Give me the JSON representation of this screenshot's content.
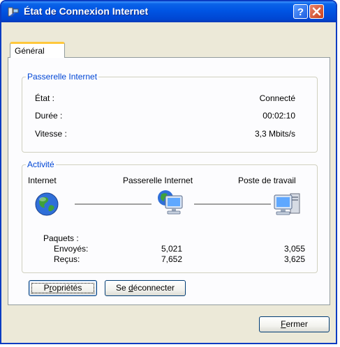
{
  "window": {
    "title": "État de Connexion Internet"
  },
  "tabs": [
    {
      "label": "Général"
    }
  ],
  "gateway": {
    "title": "Passerelle Internet",
    "rows": [
      {
        "label": "État :",
        "value": "Connecté"
      },
      {
        "label": "Durée :",
        "value": "00:02:10"
      },
      {
        "label": "Vitesse :",
        "value": "3,3 Mbits/s"
      }
    ]
  },
  "activity": {
    "title": "Activité",
    "col_internet": "Internet",
    "col_gateway": "Passerelle Internet",
    "col_computer": "Poste de travail",
    "packets_label": "Paquets :",
    "sent_label": "Envoyés:",
    "received_label": "Reçus:",
    "sent_gateway": "5,021",
    "received_gateway": "7,652",
    "sent_computer": "3,055",
    "received_computer": "3,625"
  },
  "buttons": {
    "properties_pre": "P",
    "properties_mid": "r",
    "properties_post": "opriétés",
    "disconnect_pre": "Se ",
    "disconnect_acc": "d",
    "disconnect_post": "éconnecter",
    "close_acc": "F",
    "close_post": "ermer"
  },
  "icons": {
    "title": "network-icon",
    "help": "help-icon",
    "close": "close-icon",
    "internet": "globe-icon",
    "gateway": "gateway-computer-icon",
    "computer": "computer-icon"
  }
}
